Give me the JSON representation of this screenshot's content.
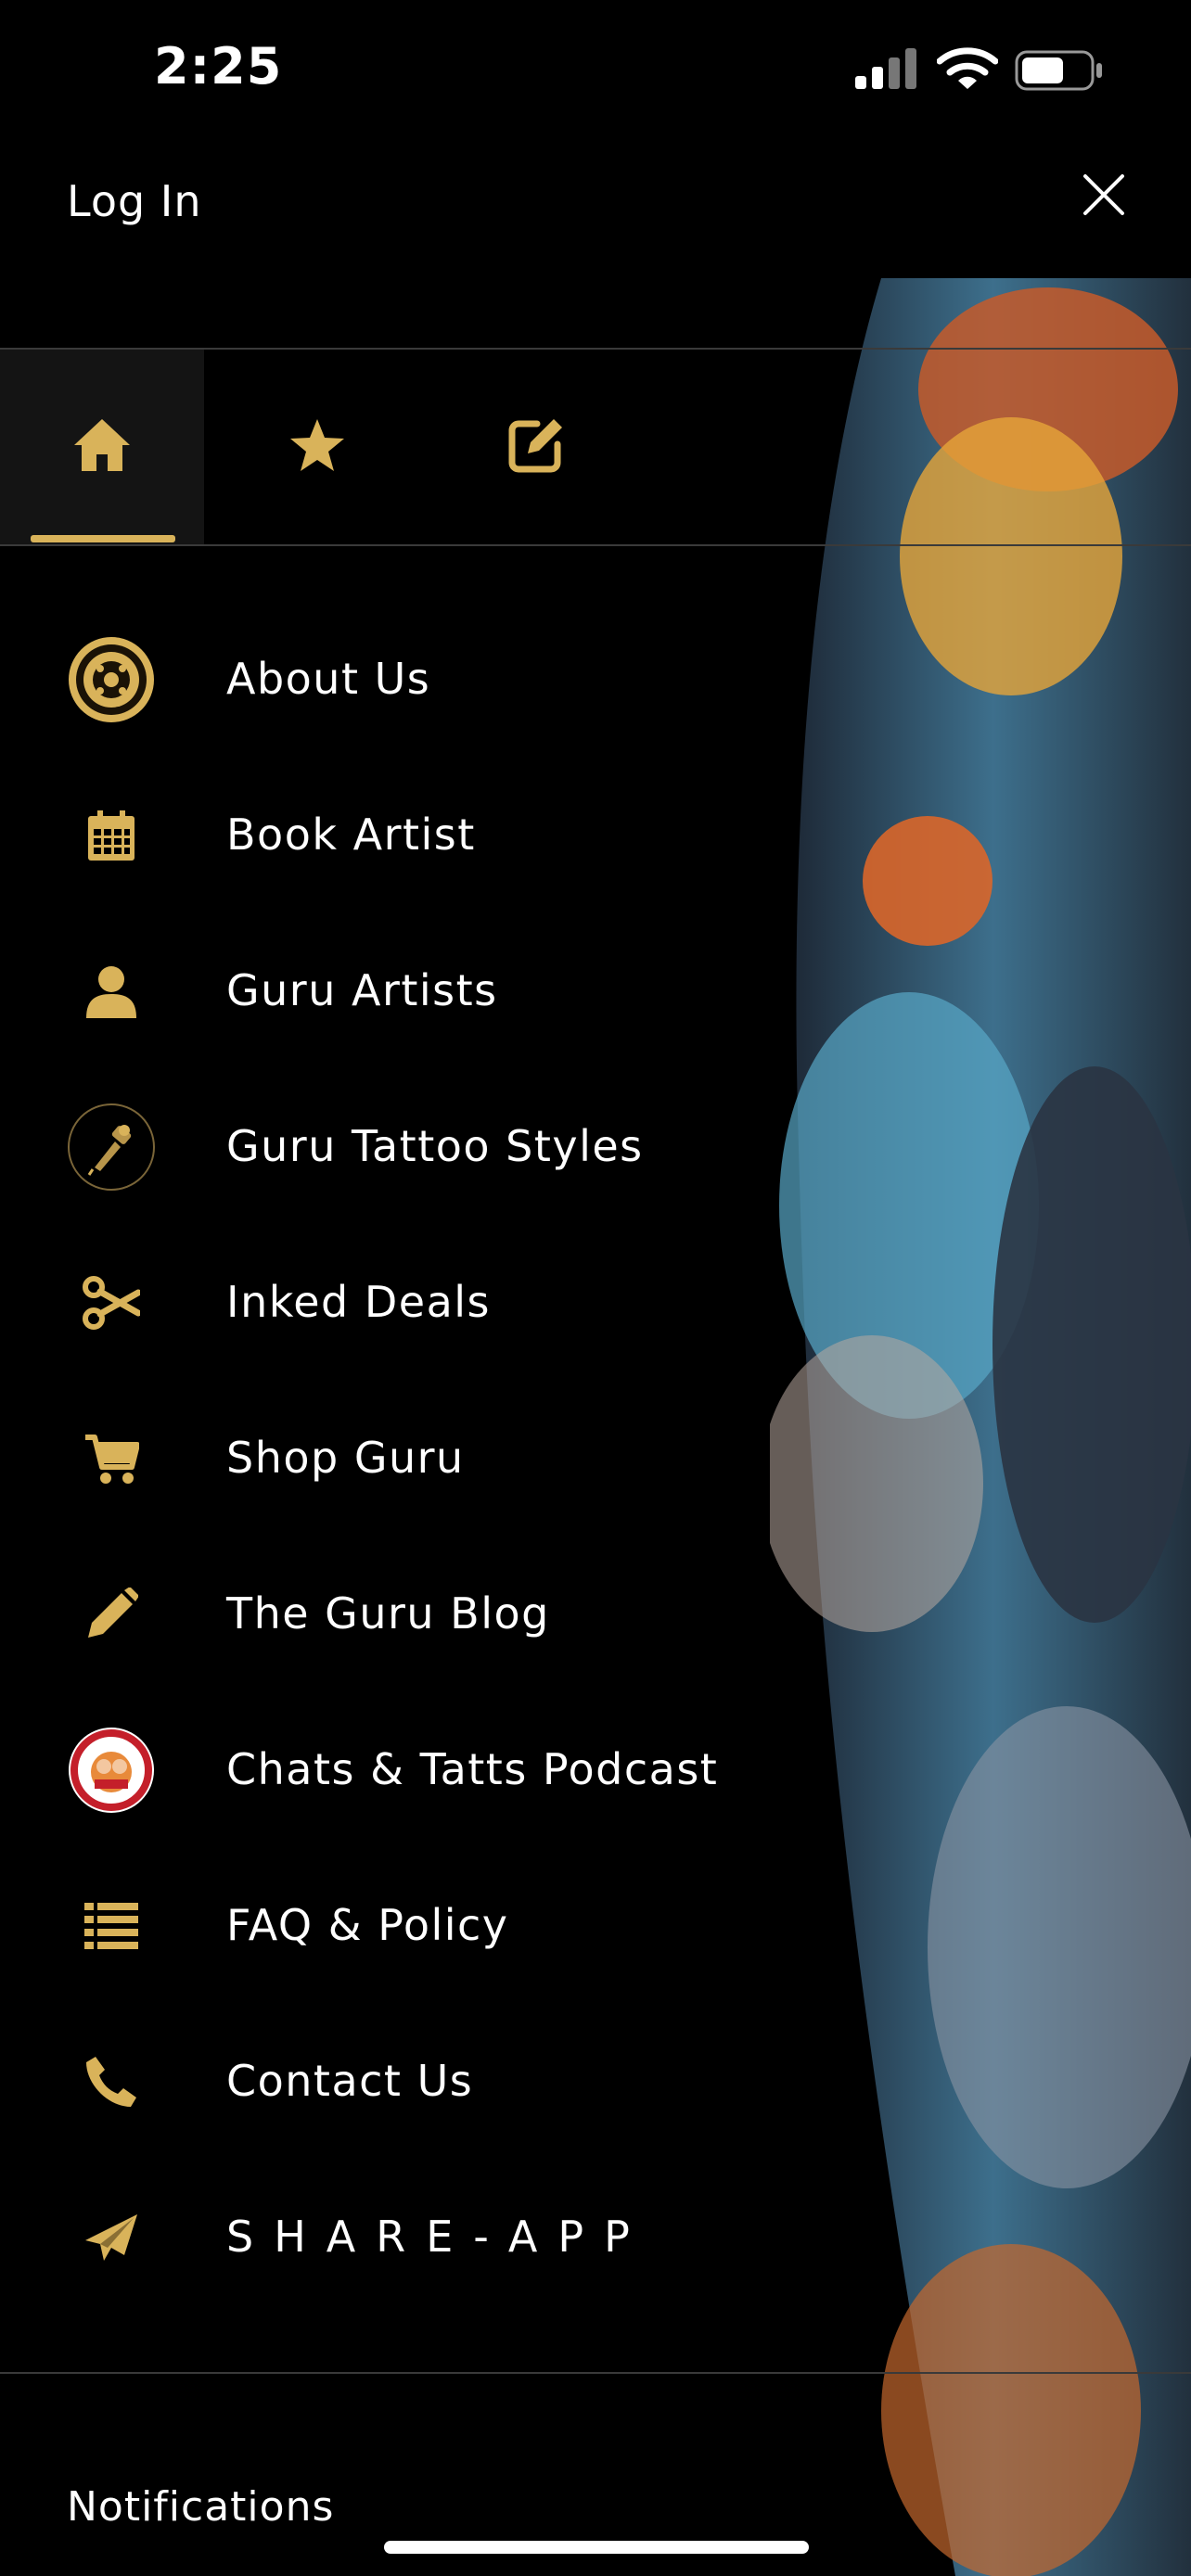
{
  "status_bar": {
    "time": "2:25"
  },
  "header": {
    "login_label": "Log In"
  },
  "tabs": [
    {
      "name": "home",
      "icon": "home-icon",
      "active": true
    },
    {
      "name": "favorites",
      "icon": "star-icon",
      "active": false
    },
    {
      "name": "edit",
      "icon": "edit-icon",
      "active": false
    }
  ],
  "menu": {
    "items": [
      {
        "label": "About Us",
        "icon": "shop-logo-icon"
      },
      {
        "label": "Book Artist",
        "icon": "calendar-icon"
      },
      {
        "label": "Guru Artists",
        "icon": "person-icon"
      },
      {
        "label": "Guru Tattoo Styles",
        "icon": "tattoo-machine-icon"
      },
      {
        "label": "Inked Deals",
        "icon": "scissors-icon"
      },
      {
        "label": "Shop Guru",
        "icon": "cart-icon"
      },
      {
        "label": "The Guru Blog",
        "icon": "pencil-icon"
      },
      {
        "label": "Chats & Tatts Podcast",
        "icon": "podcast-logo-icon"
      },
      {
        "label": "FAQ & Policy",
        "icon": "list-icon"
      },
      {
        "label": "Contact Us",
        "icon": "phone-icon"
      },
      {
        "label": "SHARE-APP",
        "icon": "paper-plane-icon"
      }
    ]
  },
  "footer": {
    "notifications_label": "Notifications"
  },
  "colors": {
    "accent": "#d9b35a",
    "background": "#000000",
    "divider": "#3a3a3a",
    "text": "#ffffff"
  }
}
